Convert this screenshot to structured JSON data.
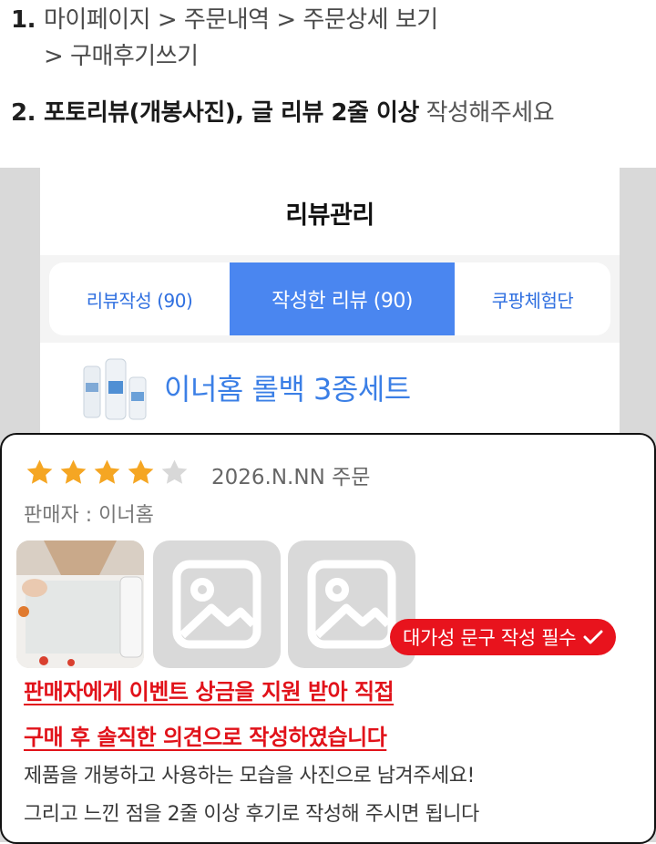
{
  "instructions": {
    "step1_num": "1.",
    "step1_text": "마이페이지 > 주문내역 > 주문상세 보기",
    "step1_cont": "> 구매후기쓰기",
    "step2_num": "2.",
    "step2_bold": "포토리뷰(개봉사진), 글 리뷰 2줄 이상",
    "step2_light": " 작성해주세요"
  },
  "app": {
    "title": "리뷰관리",
    "tabs": [
      {
        "label": "리뷰작성 (90)",
        "active": false
      },
      {
        "label": "작성한 리뷰 (90)",
        "active": true
      },
      {
        "label": "쿠팡체험단",
        "active": false
      }
    ],
    "product_name": "이너홈 롤백 3종세트"
  },
  "review": {
    "rating": 4,
    "max_rating": 5,
    "order_date": "2026.N.NN 주문",
    "seller": "판매자 : 이너홈",
    "badge_label": "대가성 문구 작성 필수",
    "disclosure_line1": "판매자에게 이벤트 상금을 지원 받아 직접",
    "disclosure_line2": "구매 후 솔직한 의견으로 작성하였습니다",
    "guide_line1": "제품을 개봉하고 사용하는 모습을 사진으로 남겨주세요!",
    "guide_line2": "그리고 느낀 점을 2줄 이상 후기로 작성해 주시면 됩니다"
  },
  "colors": {
    "accent_blue": "#4a86f0",
    "link_blue": "#3b7fe6",
    "star": "#f5a623",
    "alert_red": "#e1121a"
  },
  "icons": [
    "star-icon",
    "image-placeholder-icon",
    "check-icon"
  ]
}
